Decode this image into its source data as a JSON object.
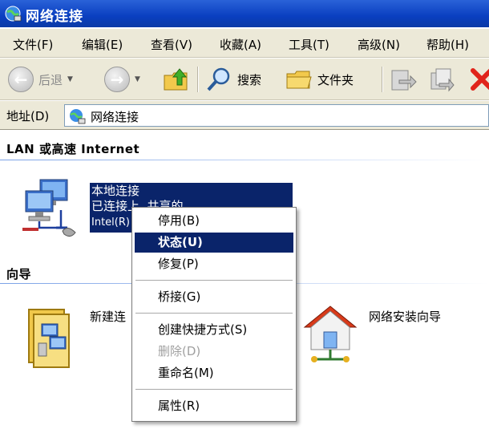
{
  "window": {
    "title": "网络连接"
  },
  "menu": [
    "文件(F)",
    "编辑(E)",
    "查看(V)",
    "收藏(A)",
    "工具(T)",
    "高级(N)",
    "帮助(H)"
  ],
  "toolbar": {
    "back": "后退",
    "search": "搜索",
    "folders": "文件夹"
  },
  "address": {
    "label": "地址(D)",
    "value": "网络连接"
  },
  "lan_section": {
    "header": "LAN 或高速 Internet",
    "connection": {
      "name": "本地连接",
      "status": "已连接上, 共享的",
      "device": "Intel(R)"
    }
  },
  "wizard_section": {
    "header": "向导",
    "items": [
      "新建连",
      "网络安装向导"
    ]
  },
  "context_menu": {
    "items": [
      {
        "label": "停用(B)"
      },
      {
        "label": "状态(U)",
        "selected": true
      },
      {
        "label": "修复(P)"
      },
      {
        "label": "桥接(G)"
      },
      {
        "label": "创建快捷方式(S)"
      },
      {
        "label": "删除(D)",
        "disabled": true
      },
      {
        "label": "重命名(M)"
      },
      {
        "label": "属性(R)"
      }
    ]
  },
  "colors": {
    "titlebar": "#0a3fc0",
    "selection": "#0a246a",
    "chrome": "#ece9d8"
  }
}
